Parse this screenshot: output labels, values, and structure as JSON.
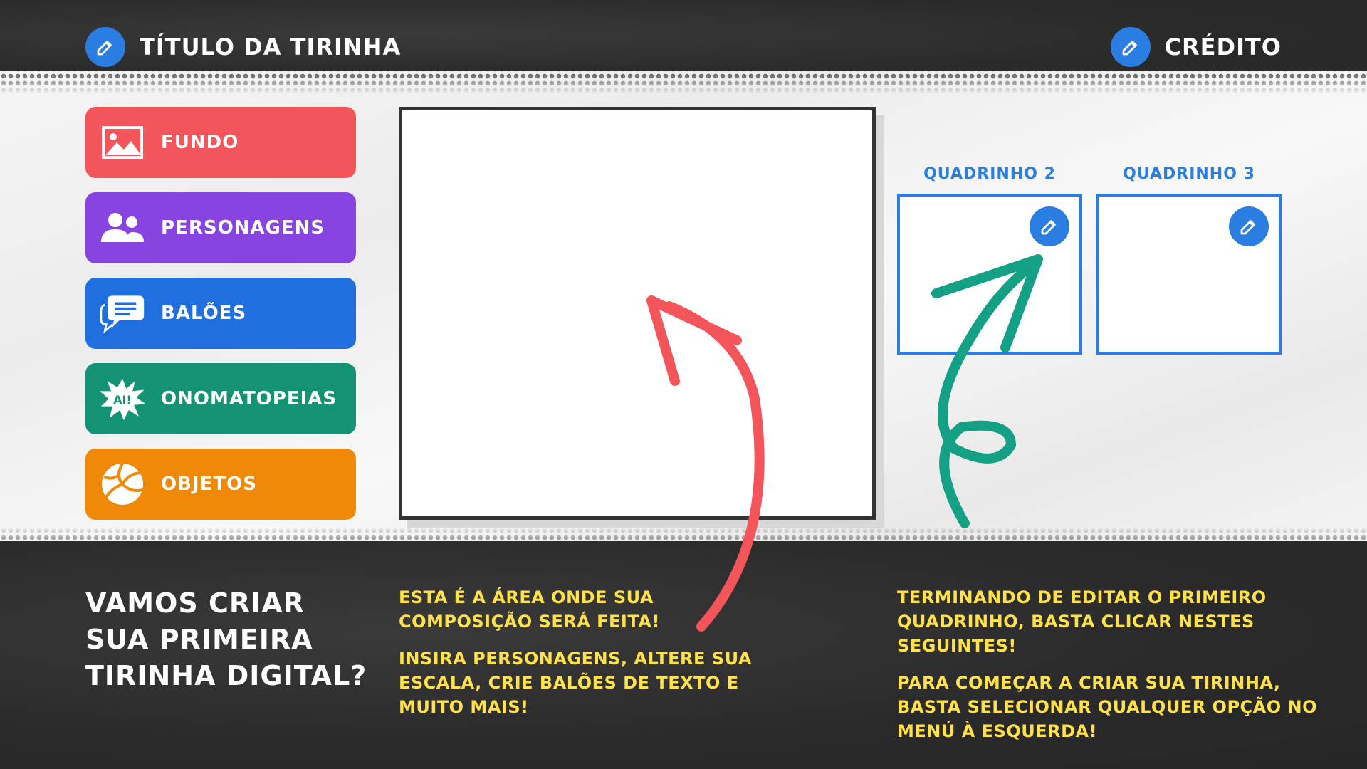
{
  "header": {
    "title": "TÍTULO DA TIRINHA",
    "credit": "CRÉDITO",
    "title_icon": "edit-icon",
    "credit_icon": "edit-icon"
  },
  "menu": {
    "items": [
      {
        "label": "FUNDO",
        "icon": "image-icon",
        "color": "#f4555b"
      },
      {
        "label": "PERSONAGENS",
        "icon": "users-icon",
        "color": "#8844e0"
      },
      {
        "label": "BALÕES",
        "icon": "speech-bubble-icon",
        "color": "#1f6fde"
      },
      {
        "label": "ONOMATOPEIAS",
        "icon": "ai-burst-icon",
        "color": "#139274",
        "icon_text": "AI!"
      },
      {
        "label": "OBJETOS",
        "icon": "volleyball-icon",
        "color": "#f08808"
      }
    ]
  },
  "panels": {
    "panel2": {
      "label": "QUADRINHO 2",
      "icon": "edit-icon"
    },
    "panel3": {
      "label": "QUADRINHO 3",
      "icon": "edit-icon"
    }
  },
  "bottom": {
    "headline": "VAMOS CRIAR SUA PRIMEIRA TIRINHA DIGITAL?",
    "center_p1": "ESTA É A ÁREA ONDE SUA COMPOSIÇÃO SERÁ FEITA!",
    "center_p2": "INSIRA PERSONAGENS, ALTERE SUA ESCALA, CRIE BALÕES DE TEXTO E MUITO MAIS!",
    "right_p1": "TERMINANDO DE EDITAR O PRIMEIRO QUADRINHO, BASTA CLICAR NESTES SEGUINTES!",
    "right_p2": "PARA COMEÇAR A CRIAR SUA TIRINHA, BASTA SELECIONAR QUALQUER OPÇÃO NO MENÚ À ESQUERDA!"
  },
  "colors": {
    "accent_blue": "#2a7de1",
    "yellow_text": "#ffe14a",
    "red_arrow": "#f4555b",
    "green_arrow": "#13a084",
    "dark_bg": "#2c2c2c"
  }
}
